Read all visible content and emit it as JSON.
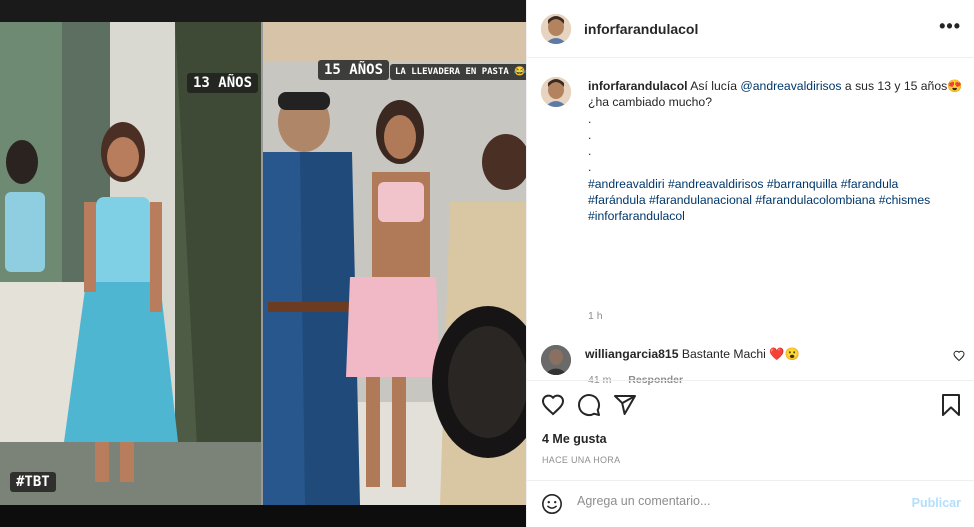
{
  "photo": {
    "sticker_13": "13 AÑOS",
    "sticker_15": "15 AÑOS",
    "sticker_pasta": "LA LLEVADERA EN PASTA 😂😂",
    "sticker_tbt": "#TBT"
  },
  "header": {
    "username": "inforfarandulacol",
    "more": "•••"
  },
  "caption": {
    "author": "inforfarandulacol",
    "text_before": " Así lucía ",
    "mention": "@andreavaldirisos",
    "text_after": " a sus 13 y 15 años😍",
    "line2": "¿ha cambiado mucho?",
    "dots": [
      ".",
      ".",
      ".",
      "."
    ],
    "hashtags": [
      "#andreavaldiri",
      "#andreavaldirisos",
      "#barranquilla",
      "#farandula",
      "#farándula",
      "#farandulanacional",
      "#farandulacolombiana",
      "#chismes",
      "#inforfarandulacol"
    ],
    "time": "1 h"
  },
  "comment": {
    "author": "williangarcia815",
    "text": " Bastante Machi ❤️😮",
    "time": "41 m",
    "reply": "Responder"
  },
  "stats": {
    "likes": "4 Me gusta",
    "when": "HACE UNA HORA"
  },
  "add_comment": {
    "placeholder": "Agrega un comentario...",
    "post": "Publicar"
  },
  "icons": [
    "heart-icon",
    "comment-icon",
    "share-icon",
    "bookmark-icon",
    "emoji-icon",
    "small-heart-icon"
  ]
}
